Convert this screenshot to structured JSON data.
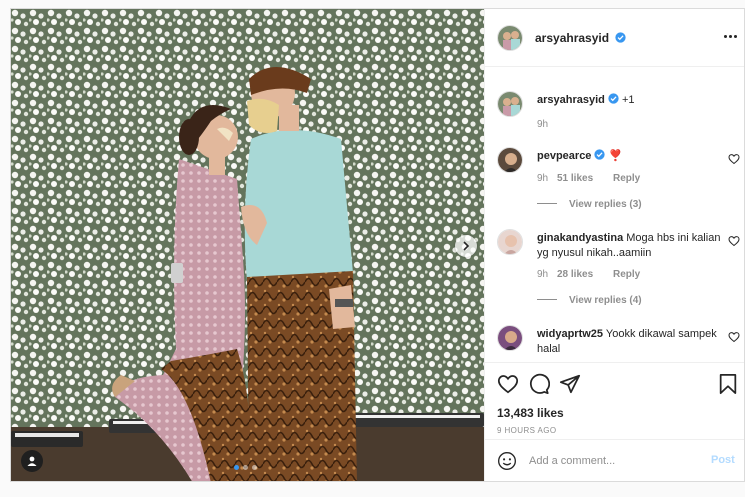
{
  "colors": {
    "accent": "#3897f0",
    "verified_badge": "#3897f0",
    "muted_text": "#8e8e8e",
    "post_button_disabled": "#b3dbff",
    "dot_active": "#3897f0"
  },
  "post": {
    "author": {
      "username": "arsyahrasyid",
      "verified": true,
      "avatar_icon": "avatar-couple-icon"
    },
    "carousel": {
      "slide_count": 3,
      "active_index": 0
    },
    "caption": {
      "username": "arsyahrasyid",
      "suffix": "+1",
      "time": "9h"
    },
    "comments": [
      {
        "username": "pevpearce",
        "verified": true,
        "text": "❣️",
        "time": "9h",
        "likes": "51 likes",
        "reply_label": "Reply",
        "view_replies": "View replies (3)"
      },
      {
        "username": "ginakandyastina",
        "verified": false,
        "text": "Moga hbs ini kalian yg nyusul nikah..aamiin",
        "time": "9h",
        "likes": "28 likes",
        "reply_label": "Reply",
        "view_replies": "View replies (4)"
      },
      {
        "username": "widyaprtw25",
        "verified": false,
        "text": "Yookk dikawal sampek halal",
        "time": "",
        "likes": "",
        "reply_label": "",
        "view_replies": ""
      }
    ],
    "likes_text": "13,483 likes",
    "time_ago": "9 HOURS AGO",
    "add_comment": {
      "placeholder": "Add a comment...",
      "value": "",
      "post_label": "Post"
    }
  }
}
